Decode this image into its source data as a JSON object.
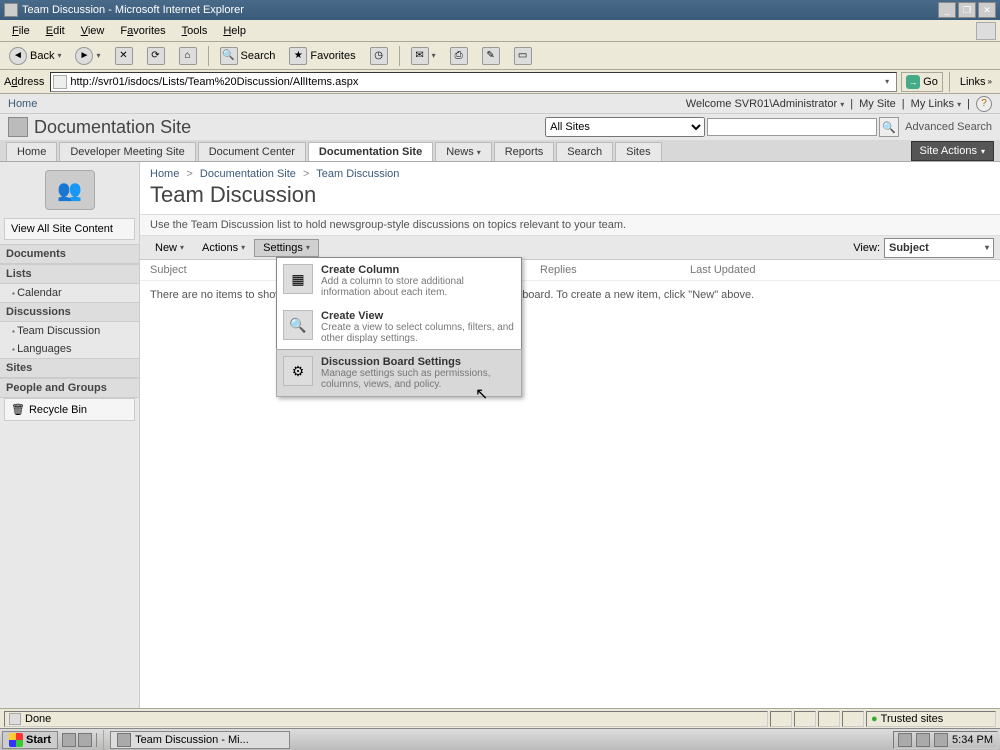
{
  "window": {
    "title": "Team Discussion - Microsoft Internet Explorer"
  },
  "menubar": [
    "File",
    "Edit",
    "View",
    "Favorites",
    "Tools",
    "Help"
  ],
  "ietoolbar": {
    "back": "Back",
    "search": "Search",
    "favorites": "Favorites"
  },
  "addrbar": {
    "label": "Address",
    "url": "http://svr01/isdocs/Lists/Team%20Discussion/AllItems.aspx",
    "go": "Go",
    "links": "Links"
  },
  "topstrip": {
    "home": "Home",
    "welcome": "Welcome SVR01\\Administrator",
    "mysite": "My Site",
    "mylinks": "My Links"
  },
  "site": {
    "title": "Documentation Site",
    "searchScope": "All Sites",
    "advanced": "Advanced Search"
  },
  "tabs": [
    {
      "label": "Home"
    },
    {
      "label": "Developer Meeting Site"
    },
    {
      "label": "Document Center"
    },
    {
      "label": "Documentation Site",
      "active": true
    },
    {
      "label": "News",
      "dd": true
    },
    {
      "label": "Reports"
    },
    {
      "label": "Search"
    },
    {
      "label": "Sites"
    }
  ],
  "siteactions": "Site Actions",
  "leftnav": {
    "viewall": "View All Site Content",
    "sections": [
      {
        "head": "Documents",
        "items": []
      },
      {
        "head": "Lists",
        "items": [
          "Calendar"
        ]
      },
      {
        "head": "Discussions",
        "items": [
          "Team Discussion",
          "Languages"
        ]
      },
      {
        "head": "Sites",
        "items": []
      },
      {
        "head": "People and Groups",
        "items": []
      }
    ],
    "recycle": "Recycle Bin"
  },
  "breadcrumb": [
    "Home",
    "Documentation Site",
    "Team Discussion"
  ],
  "page": {
    "title": "Team Discussion",
    "desc": "Use the Team Discussion list to hold newsgroup-style discussions on topics relevant to your team."
  },
  "listtoolbar": {
    "new": "New",
    "actions": "Actions",
    "settings": "Settings",
    "viewlabel": "View:",
    "view": "Subject"
  },
  "columns": [
    "Subject",
    "Replies",
    "Last Updated"
  ],
  "emptymsg": "There are no items to show in this view of the \"Team Discussion\" discussion board. To create a new item, click \"New\" above.",
  "settingsmenu": [
    {
      "title": "Create Column",
      "desc": "Add a column to store additional information about each item."
    },
    {
      "title": "Create View",
      "desc": "Create a view to select columns, filters, and other display settings."
    },
    {
      "title": "Discussion Board Settings",
      "desc": "Manage settings such as permissions, columns, views, and policy.",
      "hl": true
    }
  ],
  "statusbar": {
    "done": "Done",
    "zone": "Trusted sites"
  },
  "taskbar": {
    "start": "Start",
    "task": "Team Discussion - Mi...",
    "clock": "5:34 PM"
  }
}
